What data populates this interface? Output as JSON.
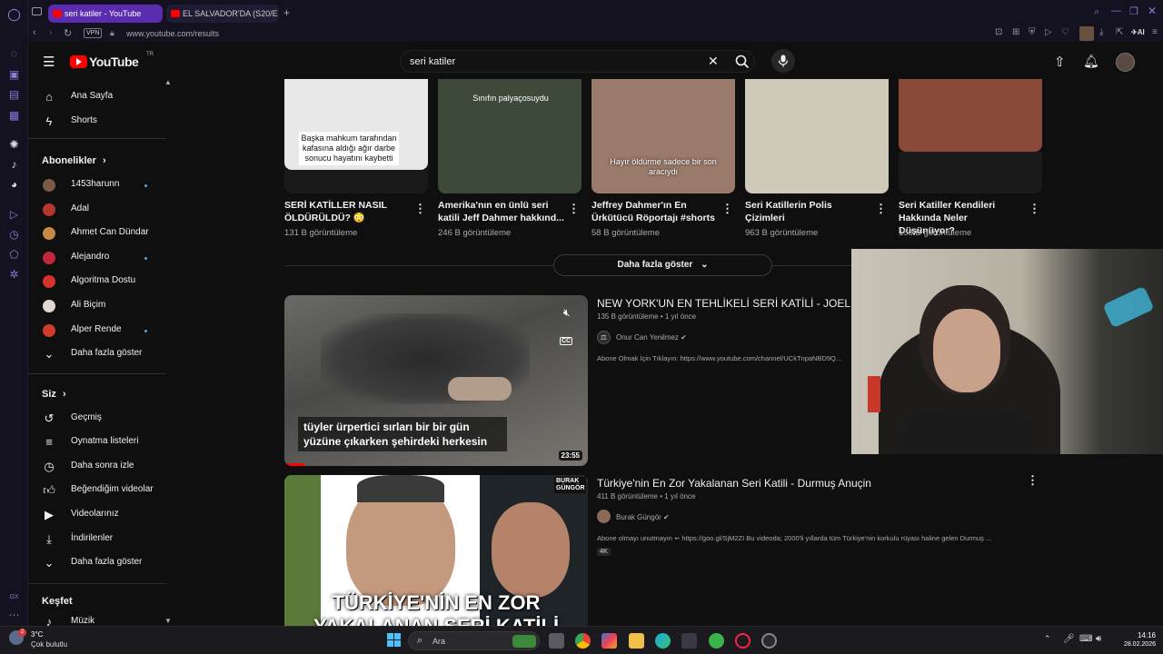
{
  "browser": {
    "tabs": [
      {
        "title": "seri katiler - YouTube",
        "active": true
      },
      {
        "title": "EL SALVADOR'DA (S20/E",
        "active": false
      }
    ],
    "new_tab": "+",
    "vpn_label": "VPN",
    "url": "www.youtube.com/results",
    "ai_label": "AI"
  },
  "youtube": {
    "logo_text": "YouTube",
    "logo_region": "TR",
    "search_value": "seri katiler"
  },
  "sidebar": {
    "main_items": [
      {
        "label": "Ana Sayfa",
        "icon": "home-icon"
      },
      {
        "label": "Shorts",
        "icon": "shorts-icon"
      }
    ],
    "subscriptions_title": "Abonelikler",
    "subscriptions": [
      {
        "label": "1453harunn",
        "new": true,
        "color": "#7a5a45"
      },
      {
        "label": "Adal",
        "new": false,
        "color": "#b3372f"
      },
      {
        "label": "Ahmet Can Dündar",
        "new": false,
        "color": "#c58a48"
      },
      {
        "label": "Alejandro",
        "new": true,
        "color": "#c2263a"
      },
      {
        "label": "Algoritma Dostu",
        "new": false,
        "color": "#d8322c"
      },
      {
        "label": "Ali Biçim",
        "new": false,
        "color": "#e0d8d0"
      },
      {
        "label": "Alper Rende",
        "new": true,
        "color": "#cf3d2a"
      }
    ],
    "subs_show_more": "Daha fazla göster",
    "you_title": "Siz",
    "you_items": [
      {
        "label": "Geçmiş",
        "icon": "history-icon"
      },
      {
        "label": "Oynatma listeleri",
        "icon": "playlist-icon"
      },
      {
        "label": "Daha sonra izle",
        "icon": "clock-icon"
      },
      {
        "label": "Beğendiğim videolar",
        "icon": "like-icon"
      },
      {
        "label": "Videolarınız",
        "icon": "video-icon"
      },
      {
        "label": "İndirilenler",
        "icon": "download-icon"
      }
    ],
    "you_show_more": "Daha fazla göster",
    "explore_title": "Keşfet",
    "explore_items": [
      {
        "label": "Müzik",
        "icon": "music-icon"
      }
    ]
  },
  "shorts": [
    {
      "title": "SERİ KATİLLER NASIL ÖLDÜRÜLDÜ? 😳",
      "views": "131 B görüntüleme",
      "caption": "Başka mahkum tarafından kafasına aldığı ağır darbe sonucu hayatını kaybetti",
      "bg": "#e8e8e8"
    },
    {
      "title": "Amerika'nın en ünlü seri katili Jeff Dahmer hakkınd...",
      "views": "246 B görüntüleme",
      "caption": "Sınıfın palyaçosuydu",
      "bg": "#3d4a3a"
    },
    {
      "title": "Jeffrey Dahmer'ın En Ürkütücü Röportajı #shorts",
      "views": "58 B görüntüleme",
      "caption": "Hayır öldürme sadece bir son aracıydı",
      "bg": "#9a7a6a"
    },
    {
      "title": "Seri Katillerin Polis Çizimleri",
      "views": "963 B görüntüleme",
      "caption": "",
      "bg": "#cfc9b8"
    },
    {
      "title": "Seri Katiller Kendileri Hakkında Neler Düşünüyor?",
      "views": "158 B görüntüleme",
      "caption": "",
      "bg": "#8a4a3a"
    }
  ],
  "show_more_button": "Daha fazla göster",
  "videos": [
    {
      "title": "NEW YORK'UN EN TEHLİKELİ SERİ KATİLİ - JOEL RIFKIN",
      "views": "135 B görüntüleme",
      "age": "1 yıl önce",
      "channel": "Onur Can Yenilmez",
      "description": "Abone Olmak İçin Tıklayın: https://www.youtube.com/channel/UCkTnpaNBD9Q...",
      "duration": "23:55",
      "thumb_caption": "tüyler ürpertici sırları bir bir gün yüzüne çıkarken şehirdeki herkesin",
      "cc": "CC"
    },
    {
      "title": "Türkiye'nin En Zor Yakalanan Seri Katili - Durmuş Anuçin",
      "views": "411 B görüntüleme",
      "age": "1 yıl önce",
      "channel": "Burak Güngör",
      "description": "Abone olmayı unutmayın ➻ https://goo.gl/SjM2ZI Bu videoda; 2000'li yıllarda tüm Türkiye'nin korkulu rüyası haline gelen Durmuş ...",
      "badge": "4K",
      "thumb_text_1": "TÜRKİYE'NİN EN ZOR",
      "thumb_text_2": "YAKALANAN SERİ KATİLİ",
      "brand_1": "BURAK",
      "brand_2": "GÜNGÖR"
    }
  ],
  "taskbar": {
    "weather_temp": "3°C",
    "weather_desc": "Çok bulutlu",
    "weather_badge": "2",
    "search_placeholder": "Ara",
    "time": "14:16",
    "date": "28.02.2026"
  },
  "colors": {
    "accent_opera": "#8a7bd6",
    "youtube_red": "#ff0000",
    "active_tab": "#5b2bb0",
    "subscription_dot": "#3ea6ff"
  }
}
